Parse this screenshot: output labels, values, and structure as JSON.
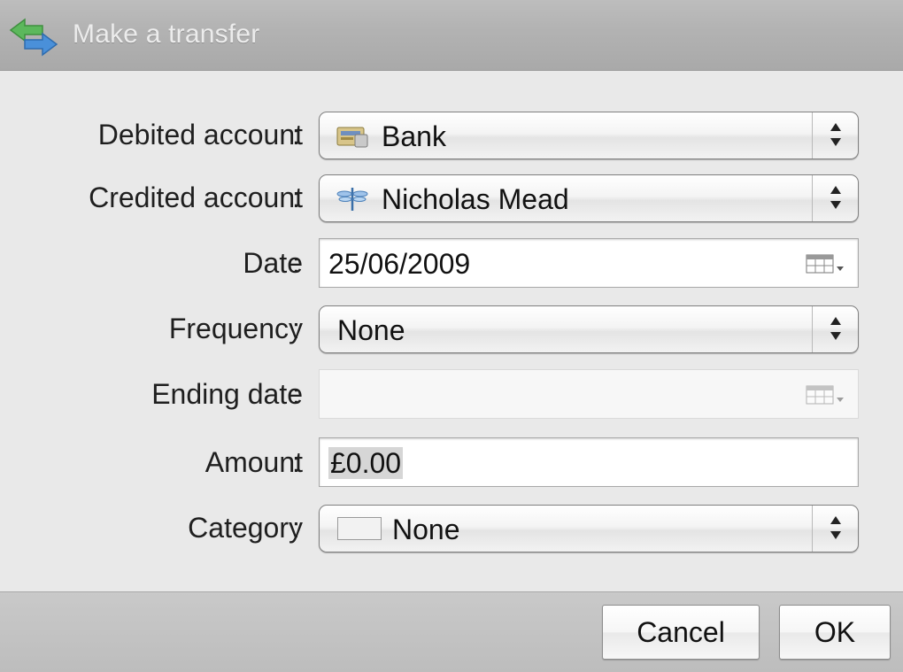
{
  "window": {
    "title": "Make a transfer"
  },
  "form": {
    "debited": {
      "label": "Debited account",
      "value": "Bank",
      "icon": "bank-account-icon"
    },
    "credited": {
      "label": "Credited account",
      "value": "Nicholas Mead",
      "icon": "dragonfly-icon"
    },
    "date": {
      "label": "Date",
      "value": "25/06/2009",
      "icon": "calendar-icon"
    },
    "frequency": {
      "label": "Frequency",
      "value": "None"
    },
    "ending_date": {
      "label": "Ending date",
      "value": "",
      "icon": "calendar-icon"
    },
    "amount": {
      "label": "Amount",
      "value": "£0.00"
    },
    "category": {
      "label": "Category",
      "value": "None",
      "swatch_color": "#f2f2f2"
    },
    "colon": ":"
  },
  "buttons": {
    "cancel": "Cancel",
    "ok": "OK"
  },
  "colors": {
    "titlebar": "#b3b3b3",
    "content_bg": "#e9e9e9",
    "footer": "#c4c4c4",
    "title_arrow_green": "#5cb85c",
    "title_arrow_blue": "#4a90d9"
  }
}
